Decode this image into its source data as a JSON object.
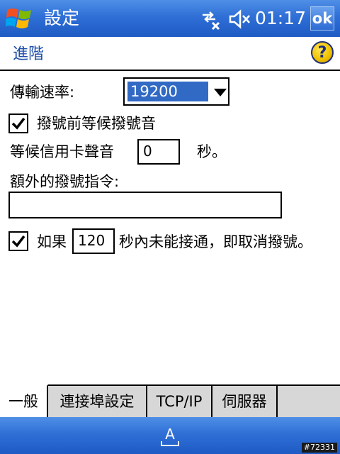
{
  "titlebar": {
    "app_title": "設定",
    "clock": "01:17",
    "ok_label": "ok"
  },
  "header": {
    "page_title": "進階",
    "help_label": "?"
  },
  "form": {
    "baud_rate": {
      "label": "傳輸速率:",
      "value": "19200"
    },
    "wait_dial_tone": {
      "label": "撥號前等候撥號音",
      "checked": true
    },
    "card_wait": {
      "label": "等候信用卡聲音",
      "value": "0",
      "unit": "秒。"
    },
    "extra_dial": {
      "label": "額外的撥號指令:",
      "value": ""
    },
    "cancel_call": {
      "checked": true,
      "prefix": "如果",
      "value": "120",
      "suffix": "秒內未能接通，即取消撥號。"
    }
  },
  "tabs": [
    {
      "label": "一般",
      "active": true
    },
    {
      "label": "連接埠設定",
      "active": false
    },
    {
      "label": "TCP/IP",
      "active": false
    },
    {
      "label": "伺服器",
      "active": false
    }
  ],
  "bottombar": {
    "keyboard_label": "A",
    "watermark": "#72331"
  },
  "colors": {
    "bar_blue": "#2f6fd6",
    "title_text": "#1f4fa8",
    "selection": "#316ac5",
    "tab_gray": "#d7d7d7"
  },
  "icons": {
    "start": "windows-logo-icon",
    "connectivity": "connectivity-icon",
    "volume": "volume-muted-icon",
    "help": "help-icon",
    "dropdown": "chevron-down-icon",
    "check": "check-icon",
    "keyboard": "keyboard-icon"
  }
}
